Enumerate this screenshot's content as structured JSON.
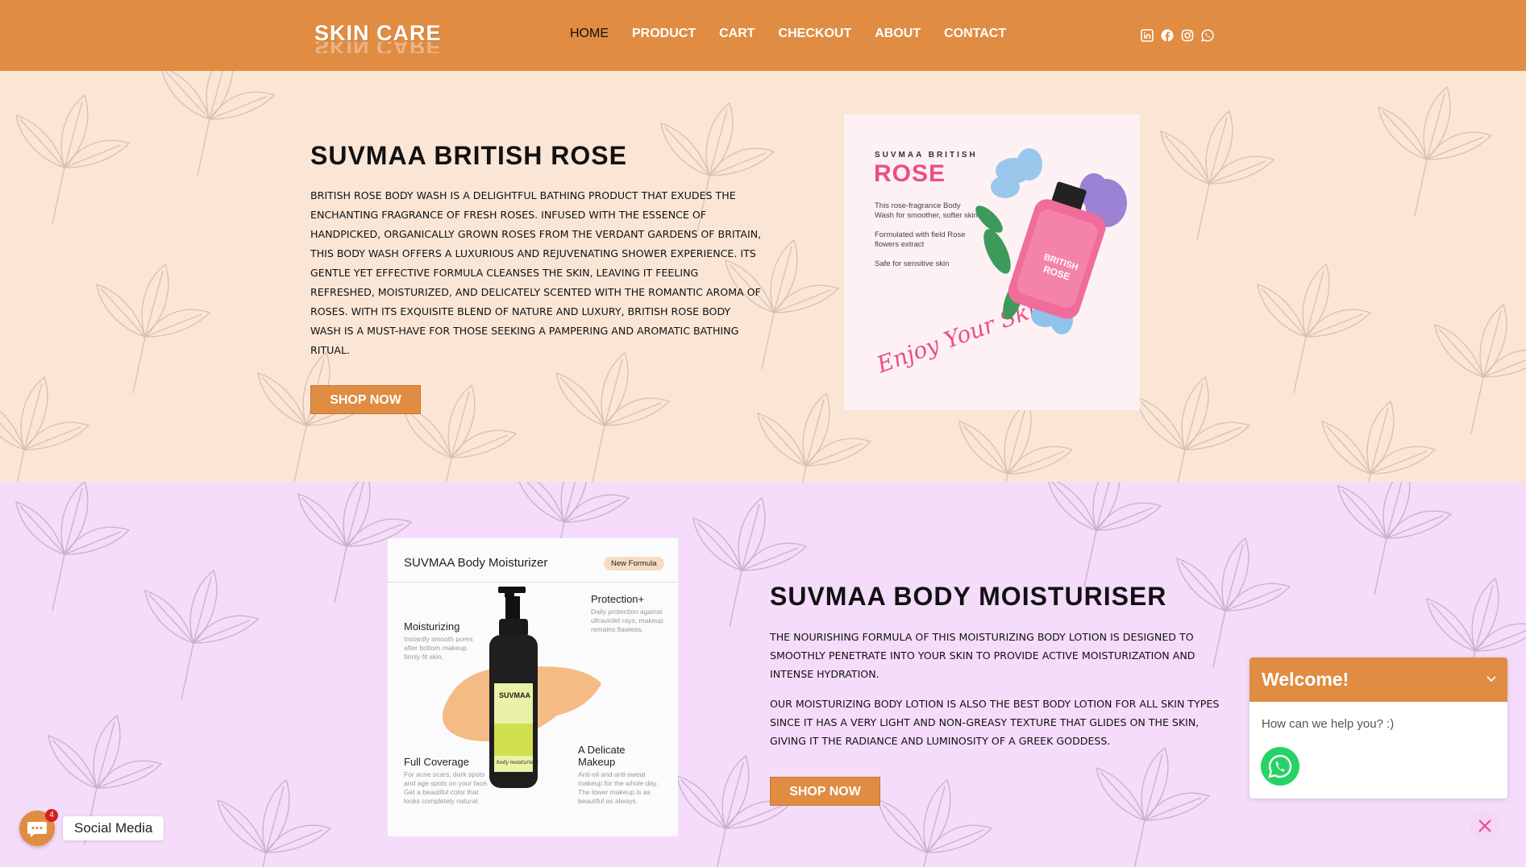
{
  "header": {
    "logo": "SKIN CARE",
    "nav": [
      {
        "label": "HOME",
        "active": true
      },
      {
        "label": "PRODUCT",
        "active": false
      },
      {
        "label": "CART",
        "active": false
      },
      {
        "label": "CHECKOUT",
        "active": false
      },
      {
        "label": "ABOUT",
        "active": false
      },
      {
        "label": "CONTACT",
        "active": false
      }
    ],
    "socials": [
      "linkedin-icon",
      "facebook-icon",
      "instagram-icon",
      "whatsapp-icon"
    ]
  },
  "product1": {
    "title": "SUVMAA BRITISH ROSE",
    "description": "BRITISH ROSE BODY WASH IS A DELIGHTFUL BATHING PRODUCT THAT EXUDES THE ENCHANTING FRAGRANCE OF FRESH ROSES. INFUSED WITH THE ESSENCE OF HANDPICKED, ORGANICALLY GROWN ROSES FROM THE VERDANT GARDENS OF BRITAIN, THIS BODY WASH OFFERS A LUXURIOUS AND REJUVENATING SHOWER EXPERIENCE. ITS GENTLE YET EFFECTIVE FORMULA CLEANSES THE SKIN, LEAVING IT FEELING REFRESHED, MOISTURIZED, AND DELICATELY SCENTED WITH THE ROMANTIC AROMA OF ROSES. WITH ITS EXQUISITE BLEND OF NATURE AND LUXURY, BRITISH ROSE BODY WASH IS A MUST-HAVE FOR THOSE SEEKING A PAMPERING AND AROMATIC BATHING RITUAL.",
    "button": "SHOP NOW",
    "image": {
      "brand": "SUVMAA BRITISH",
      "name": "ROSE",
      "bullet1": "This rose-fragrance Body Wash for smoother, softer skin",
      "bullet2": "Formulated with field Rose flowers extract",
      "bullet3": "Safe for sensitive skin",
      "script": "Enjoy Your Skin!"
    }
  },
  "product2": {
    "title": "SUVMAA BODY MOISTURISER",
    "para1": "THE NOURISHING FORMULA OF THIS MOISTURIZING BODY LOTION IS DESIGNED TO SMOOTHLY PENETRATE INTO YOUR SKIN TO PROVIDE ACTIVE MOISTURIZATION AND INTENSE HYDRATION.",
    "para2": "OUR MOISTURIZING BODY LOTION IS ALSO THE BEST BODY LOTION FOR ALL SKIN TYPES SINCE IT HAS A VERY LIGHT AND NON-GREASY TEXTURE THAT GLIDES ON THE SKIN, GIVING IT THE RADIANCE AND LUMINOSITY OF A GREEK GODDESS.",
    "button": "SHOP NOW",
    "image": {
      "title": "SUVMAA Body Moisturizer",
      "badge": "New Formula",
      "f1": "Moisturizing",
      "f1d": "Instantly smooth pores after bottom makeup firmly fit skin.",
      "f2": "Protection+",
      "f2d": "Daily protection against ultraviolet rays, makeup remains flawless.",
      "f3": "Full Coverage",
      "f3d": "For acne scars, dark spots and age spots on your face. Get a beautiful color that looks completely natural.",
      "f4": "A Delicate Makeup",
      "f4d": "Anti-oil and anti-sweat makeup for the whole day. The lower makeup is as beautiful as always.",
      "bottle_brand": "SUVMAA",
      "bottle_label": "body moisturiser"
    }
  },
  "chat": {
    "title": "Welcome!",
    "message": "How can we help you? :)"
  },
  "social_float": {
    "label": "Social Media",
    "badge": "4"
  },
  "colors": {
    "accent": "#e08c42",
    "section1_bg": "#fbe6d6",
    "section2_bg": "#f5dcfb",
    "rose_pink": "#ec4d8a",
    "whatsapp": "#25d366"
  }
}
